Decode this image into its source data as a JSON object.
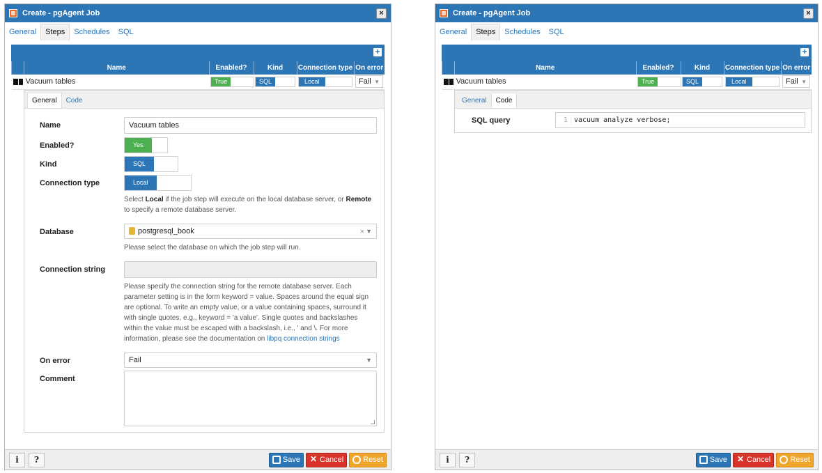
{
  "dialog": {
    "title": "Create - pgAgent Job",
    "close_label": "×",
    "tabs": [
      "General",
      "Steps",
      "Schedules",
      "SQL"
    ],
    "add_label": "+",
    "columns": [
      "Name",
      "Enabled?",
      "Kind",
      "Connection type",
      "On error"
    ],
    "step_row": {
      "name": "Vacuum tables",
      "enabled": "True",
      "kind": "SQL",
      "connection_type": "Local",
      "on_error": "Fail"
    },
    "subtabs": [
      "General",
      "Code"
    ],
    "footer": {
      "info_label": "i",
      "help_label": "?",
      "save_label": "Save",
      "cancel_label": "Cancel",
      "reset_label": "Reset"
    }
  },
  "step_general": {
    "name_label": "Name",
    "name_value": "Vacuum tables",
    "enabled_label": "Enabled?",
    "enabled_value": "Yes",
    "kind_label": "Kind",
    "kind_value": "SQL",
    "conn_type_label": "Connection type",
    "conn_type_value": "Local",
    "conn_help_1": "Select ",
    "conn_help_local": "Local",
    "conn_help_2": " if the job step will execute on the local database server, or ",
    "conn_help_remote": "Remote",
    "conn_help_3": " to specify a remote database server.",
    "database_label": "Database",
    "database_value": "postgresql_book",
    "database_clear": "×",
    "database_help": "Please select the database on which the job step will run.",
    "conn_string_label": "Connection string",
    "conn_string_help": "Please specify the connection string for the remote database server. Each parameter setting is in the form keyword = value. Spaces around the equal sign are optional. To write an empty value, or a value containing spaces, surround it with single quotes, e.g., keyword = 'a value'. Single quotes and backslashes within the value must be escaped with a backslash, i.e., ' and \\. For more information, please see the documentation on ",
    "conn_string_link": "libpq connection strings",
    "on_error_label": "On error",
    "on_error_value": "Fail",
    "comment_label": "Comment"
  },
  "step_code": {
    "sql_label": "SQL query",
    "line_number": "1",
    "sql_value": "vacuum analyze verbose;"
  },
  "colors": {
    "titlebar": "#2c76b6",
    "enabled_green": "#4cb050",
    "save_blue": "#2c76b6",
    "cancel_red": "#d9342b",
    "reset_orange": "#f0a52c"
  }
}
